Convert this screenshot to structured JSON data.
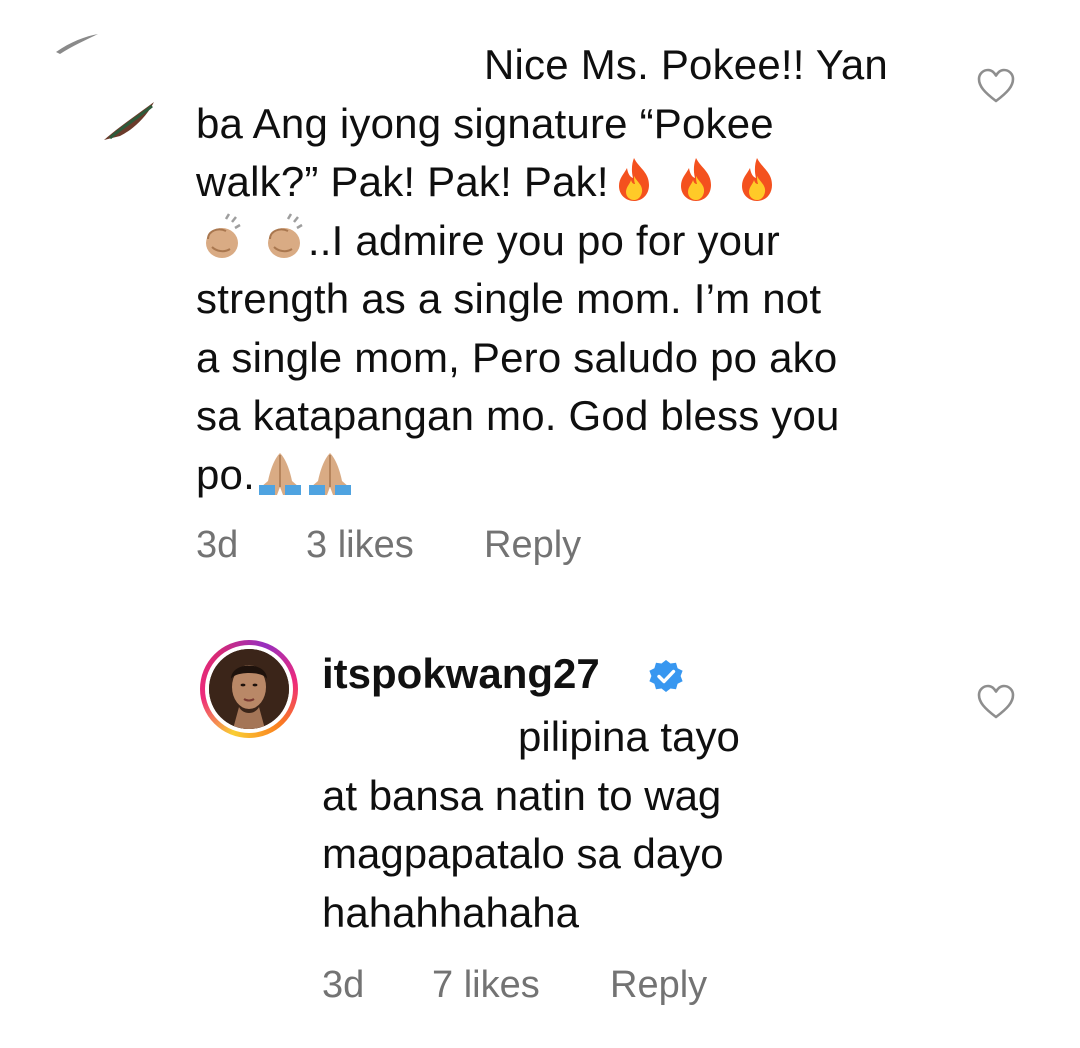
{
  "comments": [
    {
      "text_lines": [
        "Nice Ms. Pokee!! Yan",
        "ba Ang iyong signature “Pokee",
        "walk?” Pak! Pak! Pak!",
        "..I admire you po for your",
        "strength as a single mom. I’m not",
        "a single mom, Pero saludo po ako",
        "sa katapangan mo. God bless you",
        "po."
      ],
      "emoji": [
        "fire",
        "fire",
        "fire",
        "clapping-hands",
        "clapping-hands",
        "folded-hands",
        "folded-hands"
      ],
      "time": "3d",
      "likes": "3 likes",
      "reply": "Reply"
    },
    {
      "username": "itspokwang27",
      "verified": true,
      "text_lines": [
        "pilipina tayo",
        "at bansa natin to wag",
        "magpapatalo sa dayo",
        "hahahhahaha"
      ],
      "time": "3d",
      "likes": "7 likes",
      "reply": "Reply"
    }
  ],
  "icons": {
    "like": "heart-outline-icon",
    "verified": "verified-badge-icon"
  },
  "colors": {
    "text": "#111111",
    "meta": "#737373",
    "verified": "#3897f0"
  }
}
